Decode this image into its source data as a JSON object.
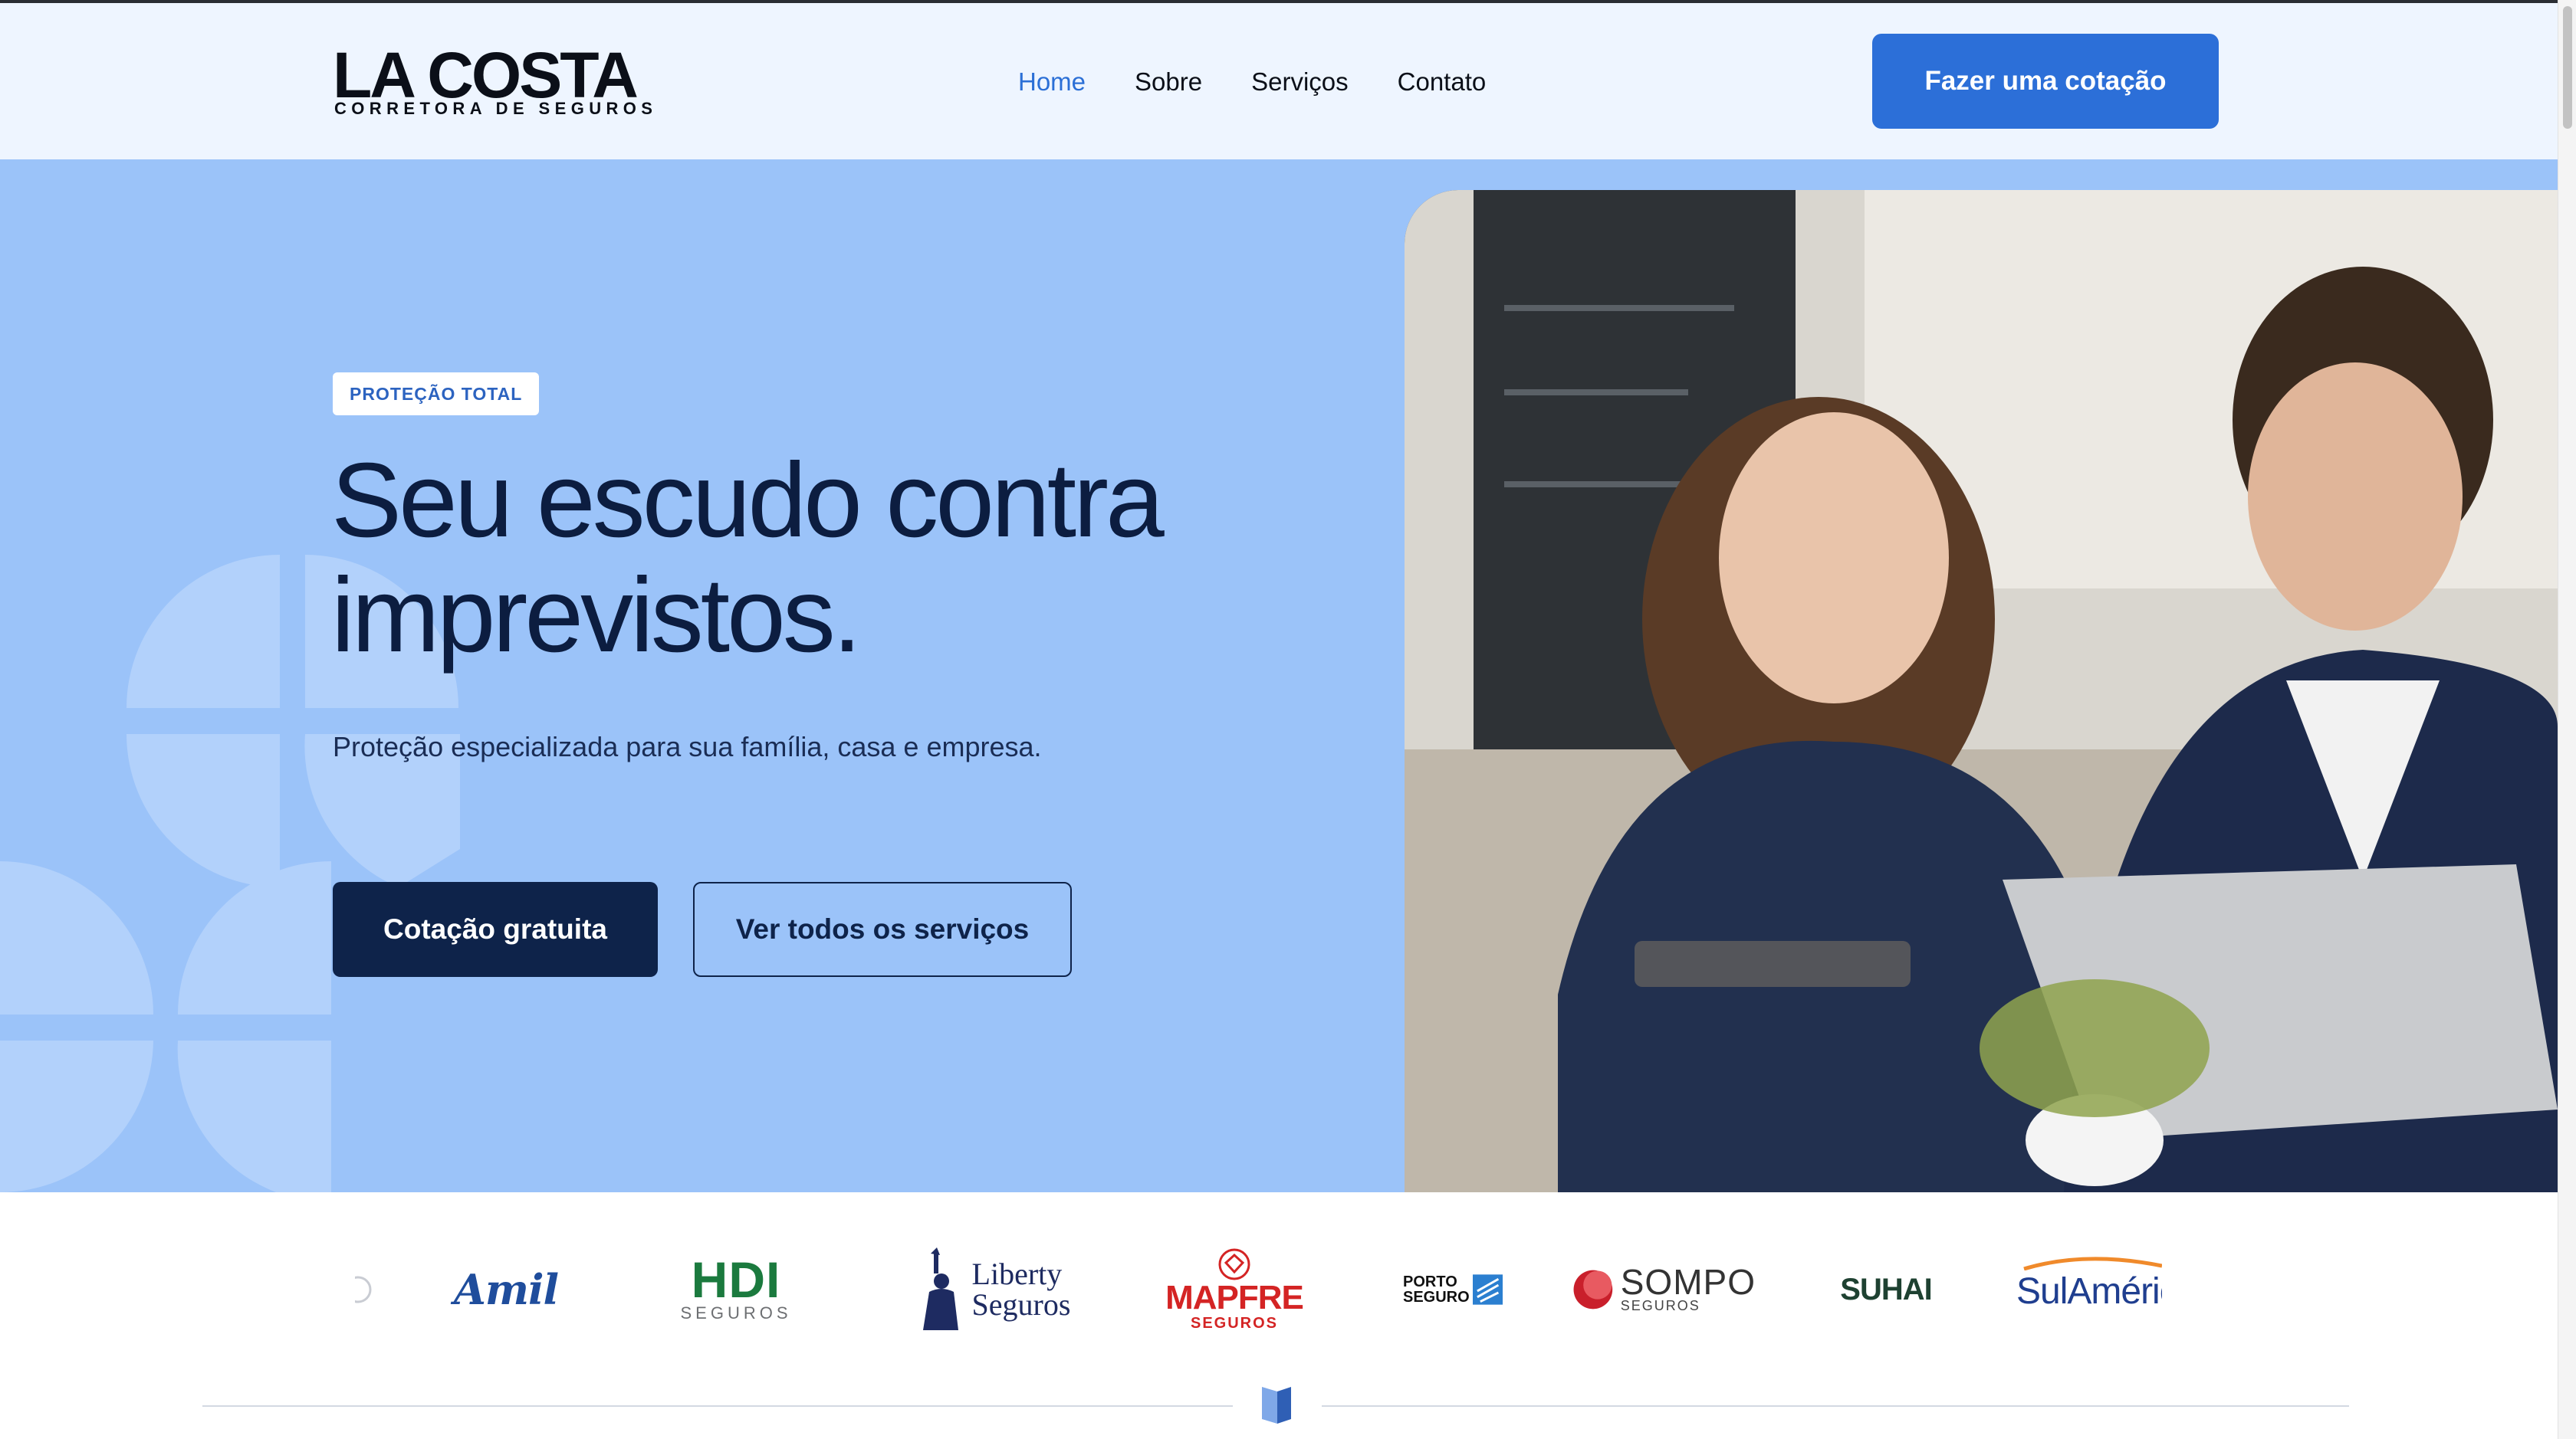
{
  "brand": {
    "name": "LA COSTA",
    "tagline": "CORRETORA DE SEGUROS"
  },
  "nav": {
    "items": [
      {
        "label": "Home",
        "active": true
      },
      {
        "label": "Sobre",
        "active": false
      },
      {
        "label": "Serviços",
        "active": false
      },
      {
        "label": "Contato",
        "active": false
      }
    ],
    "cta_label": "Fazer uma cotação"
  },
  "hero": {
    "badge": "PROTEÇÃO TOTAL",
    "title_line1": "Seu escudo contra",
    "title_line2": "imprevistos.",
    "subtitle": "Proteção especializada para sua família, casa e empresa.",
    "primary_button": "Cotação gratuita",
    "secondary_button": "Ver todos os serviços",
    "photo_icon": "photo-people-at-laptop"
  },
  "partners": {
    "amil": "Amil",
    "hdi": "HDI",
    "hdi_sub": "SEGUROS",
    "liberty_line1": "Liberty",
    "liberty_line2": "Seguros",
    "mapfre": "MAPFRE",
    "mapfre_sub": "SEGUROS",
    "porto_line1": "PORTO",
    "porto_line2": "SEGURO",
    "sompo": "SOMPO",
    "sompo_sub": "SEGUROS",
    "suhai": "SUHAI",
    "sulamerica": "SulAméric"
  },
  "colors": {
    "header_bg": "#eef5ff",
    "hero_bg": "#9bc3f9",
    "accent": "#2c6fd8",
    "navy": "#0e234a"
  }
}
